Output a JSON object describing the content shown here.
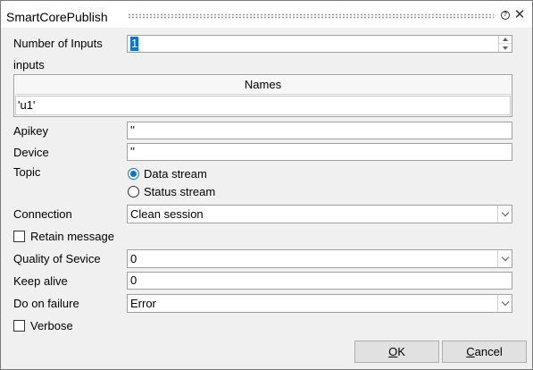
{
  "window": {
    "title": "SmartCorePublish",
    "help_glyph": "?",
    "close_glyph": "✕"
  },
  "number_of_inputs": {
    "label": "Number of Inputs",
    "value": "1"
  },
  "inputs": {
    "label": "inputs",
    "columns": [
      "Names"
    ],
    "rows": [
      [
        "'u1'"
      ]
    ]
  },
  "apikey": {
    "label": "Apikey",
    "value": "''"
  },
  "device": {
    "label": "Device",
    "value": "''"
  },
  "topic": {
    "label": "Topic",
    "options": [
      {
        "label": "Data stream",
        "selected": true
      },
      {
        "label": "Status stream",
        "selected": false
      }
    ]
  },
  "connection": {
    "label": "Connection",
    "value": "Clean session"
  },
  "retain_message": {
    "label": "Retain message",
    "checked": false
  },
  "quality_of_service": {
    "label": "Quality of Sevice",
    "value": "0"
  },
  "keep_alive": {
    "label": "Keep alive",
    "value": "0"
  },
  "do_on_failure": {
    "label": "Do on failure",
    "value": "Error"
  },
  "verbose": {
    "label": "Verbose",
    "checked": false
  },
  "buttons": {
    "ok": {
      "label": "OK",
      "mnemonic": "O",
      "rest": "K"
    },
    "cancel": {
      "label": "Cancel",
      "mnemonic": "C",
      "rest": "ancel"
    }
  },
  "colors": {
    "accent": "#0078d7",
    "dialog_bg": "#f0f0f0",
    "title_bg": "#ffffff"
  }
}
